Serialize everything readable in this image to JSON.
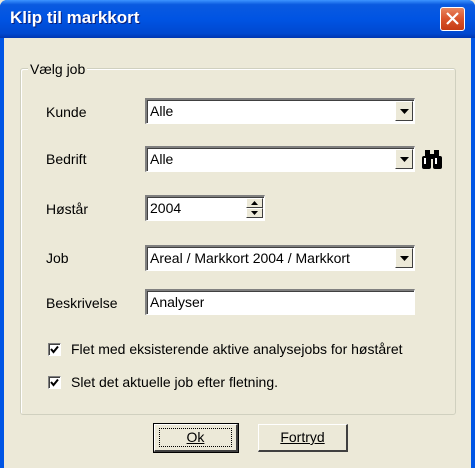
{
  "window": {
    "title": "Klip til markkort"
  },
  "group": {
    "legend": "Vælg job"
  },
  "form": {
    "kunde": {
      "label": "Kunde",
      "value": "Alle"
    },
    "bedrift": {
      "label": "Bedrift",
      "value": "Alle"
    },
    "hoestaar": {
      "label": "Høstår",
      "value": "2004"
    },
    "job": {
      "label": "Job",
      "value": "Areal / Markkort 2004 / Markkort"
    },
    "beskrivelse": {
      "label": "Beskrivelse",
      "value": "Analyser"
    }
  },
  "options": {
    "flet": {
      "label": "Flet med eksisterende aktive analysejobs for høståret",
      "checked": true
    },
    "slet": {
      "label": "Slet det aktuelle job efter fletning.",
      "checked": true
    }
  },
  "buttons": {
    "ok": "Ok",
    "cancel": "Fortryd"
  },
  "icons": {
    "close": "close-icon",
    "search": "binoculars-icon",
    "dropdown": "chevron-down-icon",
    "spin": "spin-arrows-icon",
    "check": "check-icon"
  },
  "colors": {
    "titlebar": "#0054e3",
    "close": "#d9532b",
    "dialog": "#ece9d8"
  }
}
